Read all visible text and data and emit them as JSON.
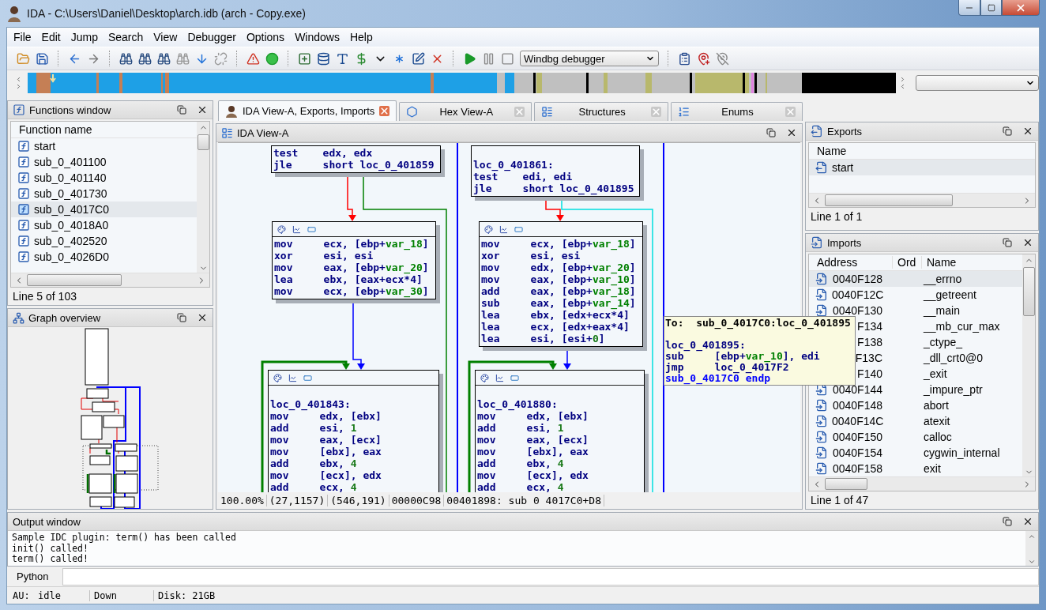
{
  "window": {
    "title": "IDA - C:\\Users\\Daniel\\Desktop\\arch.idb (arch - Copy.exe)"
  },
  "menu": [
    "File",
    "Edit",
    "Jump",
    "Search",
    "View",
    "Debugger",
    "Options",
    "Windows",
    "Help"
  ],
  "toolbar": {
    "debugger_select": "Windbg debugger"
  },
  "tabs": [
    {
      "label": "IDA View-A, Exports, Imports",
      "selected": true
    },
    {
      "label": "Hex View-A",
      "selected": false
    },
    {
      "label": "Structures",
      "selected": false
    },
    {
      "label": "Enums",
      "selected": false
    }
  ],
  "functions_window": {
    "title": "Functions window",
    "column": "Function name",
    "rows": [
      {
        "name": "start",
        "selected": false
      },
      {
        "name": "sub_0_401100",
        "selected": false
      },
      {
        "name": "sub_0_401140",
        "selected": false
      },
      {
        "name": "sub_0_401730",
        "selected": false
      },
      {
        "name": "sub_0_4017C0",
        "selected": true
      },
      {
        "name": "sub_0_4018A0",
        "selected": false
      },
      {
        "name": "sub_0_402520",
        "selected": false
      },
      {
        "name": "sub_0_4026D0",
        "selected": false
      }
    ],
    "status": "Line 5 of 103"
  },
  "graph_overview": {
    "title": "Graph overview"
  },
  "ida_view": {
    "title": "IDA View-A",
    "nodes": [
      {
        "header_icons": false,
        "lines": [
          {
            "kind": "ins",
            "m": "test",
            "a": [
              {
                "t": "edx, edx"
              }
            ]
          },
          {
            "kind": "ins",
            "m": "jle",
            "a": [
              {
                "t": "short loc_0_401859"
              }
            ]
          }
        ]
      },
      {
        "header_icons": false,
        "lines": [
          {
            "kind": "blank"
          },
          {
            "kind": "label",
            "t": "loc_0_401861:"
          },
          {
            "kind": "ins",
            "m": "test",
            "a": [
              {
                "t": "edi, edi"
              }
            ]
          },
          {
            "kind": "ins",
            "m": "jle",
            "a": [
              {
                "t": "short loc_0_401895"
              }
            ]
          }
        ]
      },
      {
        "header_icons": true,
        "lines": [
          {
            "kind": "ins",
            "m": "mov",
            "a": [
              {
                "t": "ecx, [ebp+"
              },
              {
                "t": "var_18",
                "kind": "var"
              },
              {
                "t": "]"
              }
            ]
          },
          {
            "kind": "ins",
            "m": "xor",
            "a": [
              {
                "t": "esi, esi"
              }
            ]
          },
          {
            "kind": "ins",
            "m": "mov",
            "a": [
              {
                "t": "eax, [ebp+"
              },
              {
                "t": "var_20",
                "kind": "var"
              },
              {
                "t": "]"
              }
            ]
          },
          {
            "kind": "ins",
            "m": "lea",
            "a": [
              {
                "t": "ebx, [eax+ecx*4]"
              }
            ]
          },
          {
            "kind": "ins",
            "m": "mov",
            "a": [
              {
                "t": "ecx, [ebp+"
              },
              {
                "t": "var_30",
                "kind": "var"
              },
              {
                "t": "]"
              }
            ]
          }
        ]
      },
      {
        "header_icons": true,
        "lines": [
          {
            "kind": "ins",
            "m": "mov",
            "a": [
              {
                "t": "ecx, [ebp+"
              },
              {
                "t": "var_18",
                "kind": "var"
              },
              {
                "t": "]"
              }
            ]
          },
          {
            "kind": "ins",
            "m": "xor",
            "a": [
              {
                "t": "esi, esi"
              }
            ]
          },
          {
            "kind": "ins",
            "m": "mov",
            "a": [
              {
                "t": "edx, [ebp+"
              },
              {
                "t": "var_20",
                "kind": "var"
              },
              {
                "t": "]"
              }
            ]
          },
          {
            "kind": "ins",
            "m": "mov",
            "a": [
              {
                "t": "eax, [ebp+"
              },
              {
                "t": "var_10",
                "kind": "var"
              },
              {
                "t": "]"
              }
            ]
          },
          {
            "kind": "ins",
            "m": "add",
            "a": [
              {
                "t": "eax, [ebp+"
              },
              {
                "t": "var_18",
                "kind": "var"
              },
              {
                "t": "]"
              }
            ]
          },
          {
            "kind": "ins",
            "m": "sub",
            "a": [
              {
                "t": "eax, [ebp+"
              },
              {
                "t": "var_14",
                "kind": "var"
              },
              {
                "t": "]"
              }
            ]
          },
          {
            "kind": "ins",
            "m": "lea",
            "a": [
              {
                "t": "ebx, [edx+ecx*4]"
              }
            ]
          },
          {
            "kind": "ins",
            "m": "lea",
            "a": [
              {
                "t": "ecx, [edx+eax*4]"
              }
            ]
          },
          {
            "kind": "ins",
            "m": "lea",
            "a": [
              {
                "t": "esi, [esi+"
              },
              {
                "t": "0",
                "kind": "num"
              },
              {
                "t": "]"
              }
            ]
          }
        ]
      },
      {
        "header_icons": true,
        "lines": [
          {
            "kind": "blank"
          },
          {
            "kind": "label",
            "t": "loc_0_401843:"
          },
          {
            "kind": "ins",
            "m": "mov",
            "a": [
              {
                "t": "edx, [ebx]"
              }
            ]
          },
          {
            "kind": "ins",
            "m": "add",
            "a": [
              {
                "t": "esi, "
              },
              {
                "t": "1",
                "kind": "num"
              }
            ]
          },
          {
            "kind": "ins",
            "m": "mov",
            "a": [
              {
                "t": "eax, [ecx]"
              }
            ]
          },
          {
            "kind": "ins",
            "m": "mov",
            "a": [
              {
                "t": "[ebx], eax"
              }
            ]
          },
          {
            "kind": "ins",
            "m": "add",
            "a": [
              {
                "t": "ebx, "
              },
              {
                "t": "4",
                "kind": "num"
              }
            ]
          },
          {
            "kind": "ins",
            "m": "mov",
            "a": [
              {
                "t": "[ecx], edx"
              }
            ]
          },
          {
            "kind": "ins",
            "m": "add",
            "a": [
              {
                "t": "ecx, "
              },
              {
                "t": "4",
                "kind": "num"
              }
            ]
          }
        ]
      },
      {
        "header_icons": true,
        "lines": [
          {
            "kind": "blank"
          },
          {
            "kind": "label",
            "t": "loc_0_401880:"
          },
          {
            "kind": "ins",
            "m": "mov",
            "a": [
              {
                "t": "edx, [ebx]"
              }
            ]
          },
          {
            "kind": "ins",
            "m": "add",
            "a": [
              {
                "t": "esi, "
              },
              {
                "t": "1",
                "kind": "num"
              }
            ]
          },
          {
            "kind": "ins",
            "m": "mov",
            "a": [
              {
                "t": "eax, [ecx]"
              }
            ]
          },
          {
            "kind": "ins",
            "m": "mov",
            "a": [
              {
                "t": "[ebx], eax"
              }
            ]
          },
          {
            "kind": "ins",
            "m": "add",
            "a": [
              {
                "t": "ebx, "
              },
              {
                "t": "4",
                "kind": "num"
              }
            ]
          },
          {
            "kind": "ins",
            "m": "mov",
            "a": [
              {
                "t": "[ecx], edx"
              }
            ]
          },
          {
            "kind": "ins",
            "m": "add",
            "a": [
              {
                "t": "ecx, "
              },
              {
                "t": "4",
                "kind": "num"
              }
            ]
          }
        ]
      }
    ],
    "tooltip": [
      {
        "kind": "xref",
        "m": "To:",
        "a": [
          {
            "t": "sub_0_4017C0:loc_0_401895"
          }
        ]
      },
      {
        "kind": "blank"
      },
      {
        "kind": "label",
        "t": "loc_0_401895:"
      },
      {
        "kind": "ins",
        "m": "sub",
        "a": [
          {
            "t": "[ebp+"
          },
          {
            "t": "var_10",
            "kind": "var"
          },
          {
            "t": "], edi"
          }
        ]
      },
      {
        "kind": "ins",
        "m": "jmp",
        "a": [
          {
            "t": "loc_0_4017F2"
          }
        ]
      },
      {
        "kind": "endp",
        "t": "sub_0_4017C0 endp"
      }
    ],
    "status": [
      "100.00%",
      "(27,1157)",
      "(546,191)",
      "00000C98",
      "00401898: sub 0 4017C0+D8"
    ]
  },
  "exports": {
    "title": "Exports",
    "column": "Name",
    "rows": [
      {
        "name": "start",
        "selected": true
      }
    ],
    "status": "Line 1 of 1"
  },
  "imports": {
    "title": "Imports",
    "columns": [
      "Address",
      "Ord",
      "Name"
    ],
    "rows": [
      {
        "address": "0040F128",
        "name": "__errno",
        "selected": true
      },
      {
        "address": "0040F12C",
        "name": "__getreent",
        "selected": false
      },
      {
        "address": "0040F130",
        "name": "__main",
        "selected": false
      },
      {
        "address": "F134",
        "name": "__mb_cur_max",
        "selected": false
      },
      {
        "address": "F138",
        "name": "_ctype_",
        "selected": false
      },
      {
        "address": "F13C",
        "name": "_dll_crt0@0",
        "selected": false
      },
      {
        "address": "F140",
        "name": "_exit",
        "selected": false
      },
      {
        "address": "0040F144",
        "name": "_impure_ptr",
        "selected": false
      },
      {
        "address": "0040F148",
        "name": "abort",
        "selected": false
      },
      {
        "address": "0040F14C",
        "name": "atexit",
        "selected": false
      },
      {
        "address": "0040F150",
        "name": "calloc",
        "selected": false
      },
      {
        "address": "0040F154",
        "name": "cygwin_internal",
        "selected": false
      },
      {
        "address": "0040F158",
        "name": "exit",
        "selected": false
      }
    ],
    "status": "Line 1 of 47"
  },
  "output_window": {
    "title": "Output window",
    "lines": [
      "Sample IDC plugin: term() has been called",
      "init() called!",
      "term() called!"
    ]
  },
  "python": {
    "label": "Python"
  },
  "status_bar": [
    "AU:",
    "idle",
    "Down",
    "Disk: 21GB"
  ]
}
